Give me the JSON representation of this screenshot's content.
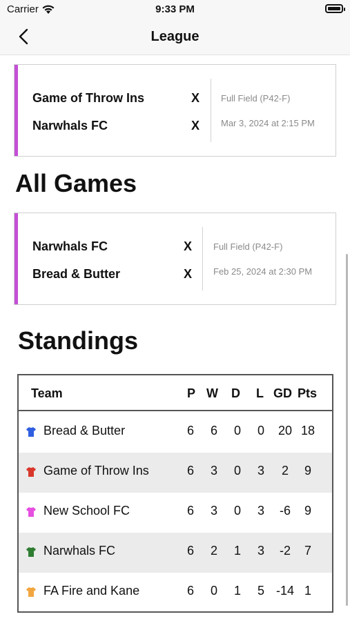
{
  "status_bar": {
    "carrier": "Carrier",
    "time": "9:33 PM"
  },
  "nav": {
    "title": "League"
  },
  "upcoming_match": {
    "home": "Game of Throw Ins",
    "home_score": "X",
    "away": "Narwhals FC",
    "away_score": "X",
    "field": "Full Field (P42-F)",
    "datetime": "Mar 3, 2024 at 2:15 PM"
  },
  "all_games": {
    "title": "All Games",
    "match": {
      "home": "Narwhals FC",
      "home_score": "X",
      "away": "Bread & Butter",
      "away_score": "X",
      "field": "Full Field (P42-F)",
      "datetime": "Feb 25, 2024 at 2:30 PM"
    }
  },
  "standings": {
    "title": "Standings",
    "headers": {
      "team": "Team",
      "p": "P",
      "w": "W",
      "d": "D",
      "l": "L",
      "gd": "GD",
      "pts": "Pts"
    },
    "rows": [
      {
        "team": "Bread & Butter",
        "shirt_color": "#2f5fe0",
        "p": "6",
        "w": "6",
        "d": "0",
        "l": "0",
        "gd": "20",
        "pts": "18"
      },
      {
        "team": "Game of Throw Ins",
        "shirt_color": "#d8382b",
        "p": "6",
        "w": "3",
        "d": "0",
        "l": "3",
        "gd": "2",
        "pts": "9"
      },
      {
        "team": "New School FC",
        "shirt_color": "#e64fe0",
        "p": "6",
        "w": "3",
        "d": "0",
        "l": "3",
        "gd": "-6",
        "pts": "9"
      },
      {
        "team": "Narwhals FC",
        "shirt_color": "#2e7d32",
        "p": "6",
        "w": "2",
        "d": "1",
        "l": "3",
        "gd": "-2",
        "pts": "7"
      },
      {
        "team": "FA Fire and Kane",
        "shirt_color": "#f2a640",
        "p": "6",
        "w": "0",
        "d": "1",
        "l": "5",
        "gd": "-14",
        "pts": "1"
      }
    ]
  },
  "colors": {
    "card_accent": "#c44fd6",
    "alt_row": "#ebebeb"
  },
  "icons": {
    "back": "chevron-left-icon",
    "wifi": "wifi-icon",
    "battery": "battery-icon",
    "shirt": "shirt-icon"
  }
}
